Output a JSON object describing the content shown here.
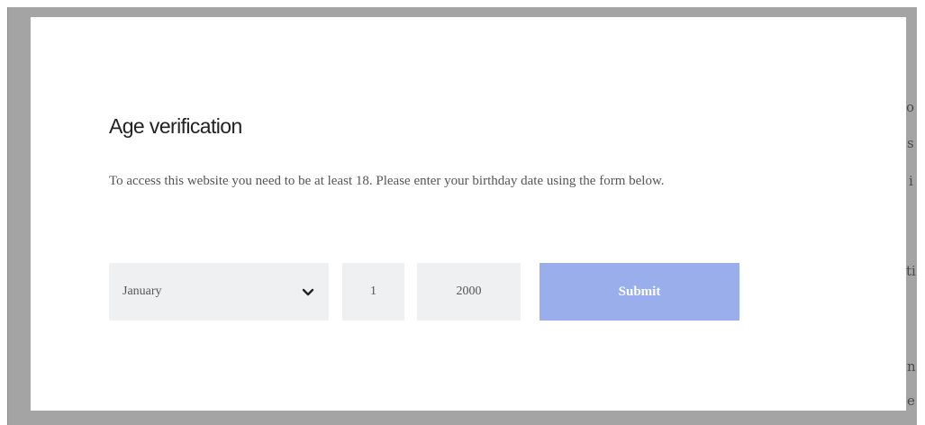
{
  "background_text": {
    "fragments": [
      "o",
      "s",
      "i",
      "ti",
      "n",
      "e"
    ]
  },
  "modal": {
    "title": "Age verification",
    "description": "To access this website you need to be at least 18. Please enter your birthday date using the form below.",
    "month_select": {
      "value": "January",
      "icon": "chevron-down-icon"
    },
    "day_input": {
      "value": "1"
    },
    "year_input": {
      "value": "2000"
    },
    "submit_label": "Submit"
  },
  "colors": {
    "overlay": "#a4a4a4",
    "field_background": "#eff0f2",
    "submit_background": "#9baeec",
    "submit_text": "#ffffff"
  }
}
